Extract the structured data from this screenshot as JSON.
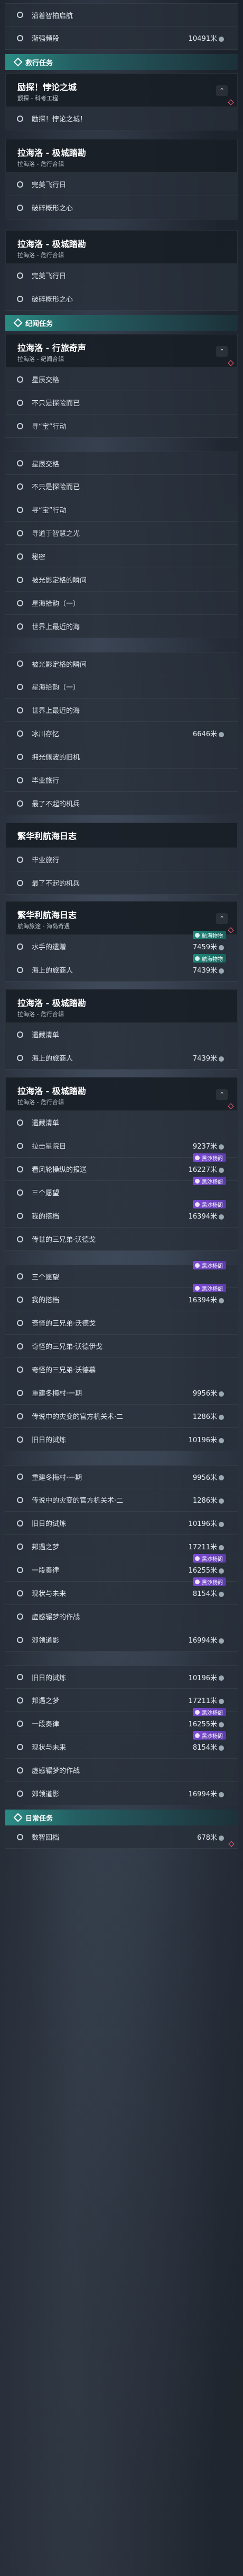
{
  "top_rows": [
    {
      "label": "沿着智拍启航",
      "reward": ""
    },
    {
      "label": "渐强频段",
      "reward": "10491米"
    }
  ],
  "section_story": {
    "title": "救行任务"
  },
  "block1": {
    "group": {
      "title": "励探！悖论之城",
      "subtitle": "颤探 - 科考工程"
    },
    "rows": [
      {
        "label": "励探！悖论之城！"
      }
    ]
  },
  "block2": {
    "group": {
      "title": "拉海洛 - 极城踏勘",
      "subtitle": "拉海洛 - 危行合辑"
    },
    "rows": [
      {
        "label": "完美飞行日"
      },
      {
        "label": "破碎概形之心"
      }
    ]
  },
  "block3": {
    "group": {
      "title": "拉海洛 - 极城踏勘",
      "subtitle": "拉海洛 - 危行合辑"
    },
    "rows": [
      {
        "label": "完美飞行日"
      },
      {
        "label": "破碎概形之心"
      }
    ]
  },
  "section_record": {
    "title": "纪闻任务"
  },
  "block4": {
    "group": {
      "title": "拉海洛 - 行旅奇声",
      "subtitle": "拉海洛 - 纪闻合辑"
    },
    "rows": [
      {
        "label": "星辰交格"
      },
      {
        "label": "不只是探险而已"
      },
      {
        "label": "寻“宝”行动"
      }
    ]
  },
  "block5_rows": [
    {
      "label": "星辰交格"
    },
    {
      "label": "不只是探险而已"
    },
    {
      "label": "寻“宝”行动"
    },
    {
      "label": "寻道于智慧之光"
    },
    {
      "label": "秘密"
    },
    {
      "label": "被光影定格的瞬间"
    },
    {
      "label": "星海拾韵（一）"
    },
    {
      "label": "世界上最近的海"
    }
  ],
  "block6_rows": [
    {
      "label": "被光影定格的瞬间",
      "reward": ""
    },
    {
      "label": "星海拾韵（一）",
      "reward": ""
    },
    {
      "label": "世界上最近的海",
      "reward": ""
    },
    {
      "label": "冰川存忆",
      "reward": "6646米"
    },
    {
      "label": "拥光佩波的旧机",
      "reward": ""
    },
    {
      "label": "毕业旅行",
      "reward": ""
    },
    {
      "label": "最了不起的机兵",
      "reward": ""
    }
  ],
  "block7": {
    "head": "繁华利航海日志",
    "rows": [
      {
        "label": "毕业旅行"
      },
      {
        "label": "最了不起的机兵"
      }
    ]
  },
  "block8": {
    "group": {
      "title": "繁华利航海日志",
      "subtitle": "航海旅途 - 海岛奇遇"
    },
    "rows": [
      {
        "label": "水手的遗赠",
        "reward": "7459米",
        "badge": "航海物物"
      },
      {
        "label": "海上的旅商人",
        "reward": "7439米",
        "badge": "航海物物"
      }
    ]
  },
  "block9": {
    "group": {
      "title": "拉海洛 - 极城踏勘",
      "subtitle": "拉海洛 - 危行合辑"
    },
    "rows": [
      {
        "label": "遗藏清单",
        "reward": ""
      },
      {
        "label": "海上的旅商人",
        "reward": "7439米"
      }
    ]
  },
  "block10": {
    "group": {
      "title": "拉海洛 - 极城踏勘",
      "subtitle": "拉海洛 - 危行合辑"
    },
    "rows": [
      {
        "label": "遗藏清单",
        "reward": "",
        "badge": ""
      },
      {
        "label": "拉击星院日",
        "reward": "9237米",
        "badge": ""
      },
      {
        "label": "看风轮操纵的报送",
        "reward": "16227米",
        "badge": "黑沙杨阁"
      },
      {
        "label": "三个愿望",
        "reward": "",
        "badge": "黑沙杨阁"
      },
      {
        "label": "我的搭档",
        "reward": "16394米",
        "badge": "黑沙杨阁"
      },
      {
        "label": "传世的三兄弟·沃德戈",
        "reward": "",
        "badge": ""
      }
    ]
  },
  "block11_rows": [
    {
      "label": "三个愿望",
      "reward": "",
      "badge": "黑沙杨阁"
    },
    {
      "label": "我的搭档",
      "reward": "16394米",
      "badge": "黑沙杨阁"
    },
    {
      "label": "奇怪的三兄弟·沃德戈",
      "reward": "",
      "badge": ""
    },
    {
      "label": "奇怪的三兄弟·沃德伊戈",
      "reward": "",
      "badge": ""
    },
    {
      "label": "奇怪的三兄弟·沃德慕",
      "reward": "",
      "badge": ""
    },
    {
      "label": "重建冬梅村·一期",
      "reward": "9956米",
      "badge": ""
    },
    {
      "label": "传说中的灾变的官方机关术·二",
      "reward": "1286米",
      "badge": ""
    },
    {
      "label": "旧日的试炼",
      "reward": "10196米",
      "badge": ""
    }
  ],
  "block12_rows": [
    {
      "label": "重建冬梅村·一期",
      "reward": "9956米",
      "badge": ""
    },
    {
      "label": "传说中的灾变的官方机关术·二",
      "reward": "1286米",
      "badge": ""
    },
    {
      "label": "旧日的试炼",
      "reward": "10196米",
      "badge": ""
    },
    {
      "label": "邦遇之梦",
      "reward": "17211米",
      "badge": ""
    },
    {
      "label": "一段奏律",
      "reward": "16255米",
      "badge": "黑沙杨阁"
    },
    {
      "label": "现状与未来",
      "reward": "8154米",
      "badge": "黑沙杨阁"
    },
    {
      "label": "虚感辗梦的作战",
      "reward": "",
      "badge": ""
    },
    {
      "label": "郊领道影",
      "reward": "16994米",
      "badge": ""
    }
  ],
  "block13_rows": [
    {
      "label": "旧日的试炼",
      "reward": "10196米",
      "badge": ""
    },
    {
      "label": "邦遇之梦",
      "reward": "17211米",
      "badge": ""
    },
    {
      "label": "一段奏律",
      "reward": "16255米",
      "badge": "黑沙杨阁"
    },
    {
      "label": "现状与未来",
      "reward": "8154米",
      "badge": "黑沙杨阁"
    },
    {
      "label": "虚感辗梦的作战",
      "reward": "",
      "badge": ""
    },
    {
      "label": "郊领道影",
      "reward": "16994米",
      "badge": ""
    }
  ],
  "section_daily": {
    "title": "日常任务"
  },
  "daily_rows": [
    {
      "label": "数智回档",
      "reward": "678米"
    }
  ]
}
